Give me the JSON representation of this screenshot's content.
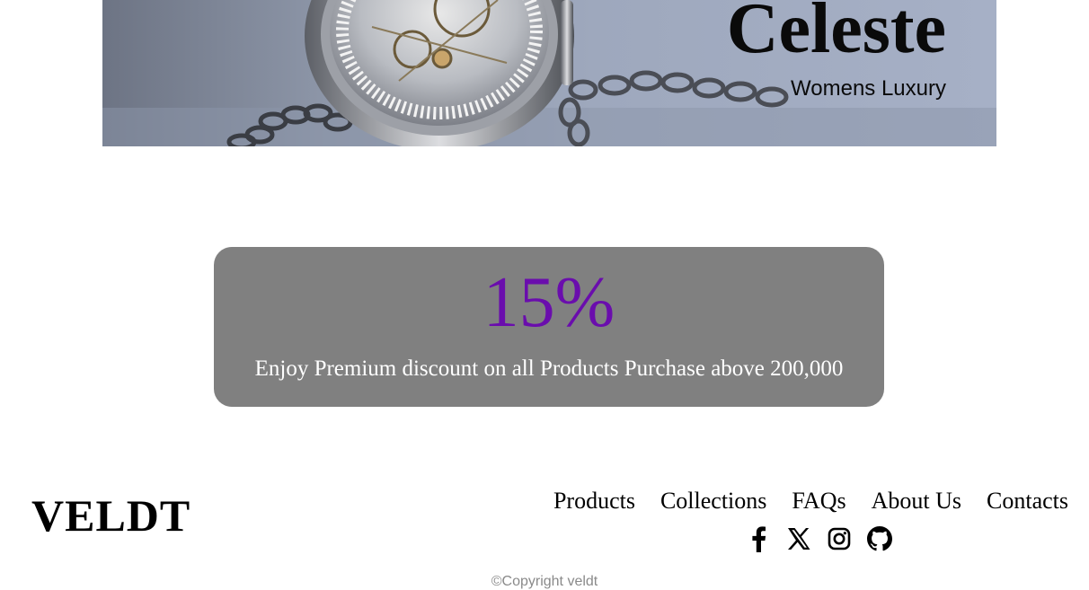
{
  "hero": {
    "title": "Celeste",
    "subtitle": "Womens Luxury",
    "image": "pocket-watch-photo"
  },
  "promo": {
    "value": "15%",
    "text": "Enjoy Premium discount on all Products Purchase above 200,000",
    "value_color": "#6a0dad",
    "card_color": "#808080"
  },
  "footer": {
    "brand": "VELDT",
    "nav": [
      "Products",
      "Collections",
      "FAQs",
      "About Us",
      "Contacts"
    ],
    "social": [
      "facebook-icon",
      "x-icon",
      "instagram-icon",
      "github-icon"
    ],
    "copyright": "©Copyright veldt"
  }
}
